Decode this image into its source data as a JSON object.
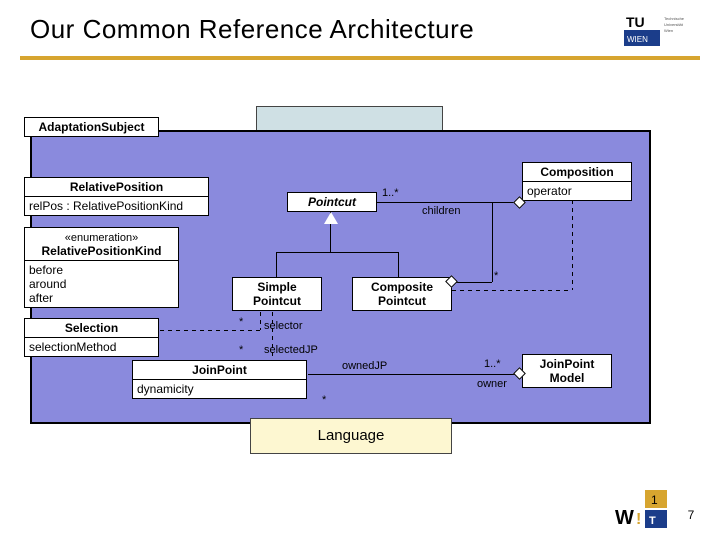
{
  "header": {
    "title": "Our Common Reference Architecture"
  },
  "panel": {
    "language_label": "Language"
  },
  "uml": {
    "adaptation_subject": {
      "name": "AdaptationSubject"
    },
    "relative_position": {
      "name": "RelativePosition",
      "attr": "relPos : RelativePositionKind"
    },
    "relative_position_kind": {
      "stereotype": "«enumeration»",
      "name": "RelativePositionKind",
      "literals": "before\naround\nafter"
    },
    "selection": {
      "name": "Selection",
      "attr": "selectionMethod"
    },
    "pointcut": {
      "name": "Pointcut"
    },
    "simple_pointcut": {
      "name": "Simple\nPointcut"
    },
    "composite_pointcut": {
      "name": "Composite\nPointcut"
    },
    "composition": {
      "name": "Composition",
      "attr": "operator"
    },
    "join_point": {
      "name": "JoinPoint",
      "attr": "dynamicity"
    },
    "join_point_model": {
      "name": "JoinPoint\nModel"
    }
  },
  "labels": {
    "one_or_more": "1..*",
    "star": "*",
    "children": "children",
    "selector": "selector",
    "selectedJP": "selectedJP",
    "ownedJP": "ownedJP",
    "owner": "owner"
  },
  "footer": {
    "page": "7"
  },
  "chart_data": {
    "type": "table",
    "description": "UML class diagram – Common Reference Architecture, Language package",
    "classes": [
      {
        "name": "AdaptationSubject"
      },
      {
        "name": "RelativePosition",
        "attributes": [
          "relPos : RelativePositionKind"
        ]
      },
      {
        "name": "RelativePositionKind",
        "stereotype": "enumeration",
        "literals": [
          "before",
          "around",
          "after"
        ]
      },
      {
        "name": "Selection",
        "attributes": [
          "selectionMethod"
        ]
      },
      {
        "name": "Pointcut",
        "abstract": true
      },
      {
        "name": "SimplePointcut",
        "generalizes": "Pointcut"
      },
      {
        "name": "CompositePointcut",
        "generalizes": "Pointcut"
      },
      {
        "name": "Composition",
        "attributes": [
          "operator"
        ]
      },
      {
        "name": "JoinPoint",
        "attributes": [
          "dynamicity"
        ]
      },
      {
        "name": "JoinPointModel"
      }
    ],
    "relationships": [
      {
        "from": "SimplePointcut",
        "to": "Pointcut",
        "kind": "generalization"
      },
      {
        "from": "CompositePointcut",
        "to": "Pointcut",
        "kind": "generalization"
      },
      {
        "from": "Composition",
        "to": "Pointcut",
        "kind": "aggregation",
        "end_to": {
          "mult": "1..*",
          "role": "children"
        }
      },
      {
        "from": "CompositePointcut",
        "to": "Composition",
        "kind": "dependency"
      },
      {
        "from": "CompositePointcut",
        "to": "Pointcut",
        "kind": "aggregation",
        "end_from": {
          "mult": "*"
        }
      },
      {
        "from": "SimplePointcut",
        "to": "Selection",
        "kind": "association",
        "end_to": {
          "mult": "*",
          "role": "selector"
        }
      },
      {
        "from": "SimplePointcut",
        "to": "JoinPoint",
        "kind": "association",
        "end_to": {
          "mult": "*",
          "role": "selectedJP"
        }
      },
      {
        "from": "JoinPoint",
        "to": "JoinPointModel",
        "kind": "association",
        "end_from": {
          "mult": "*",
          "role": "ownedJP"
        },
        "end_to": {
          "mult": "1..*",
          "role": "owner"
        }
      },
      {
        "from": "RelativePosition",
        "to": "AdaptationSubject",
        "kind": "dependency"
      },
      {
        "from": "RelativePosition",
        "to": "RelativePositionKind",
        "kind": "dependency"
      }
    ]
  }
}
